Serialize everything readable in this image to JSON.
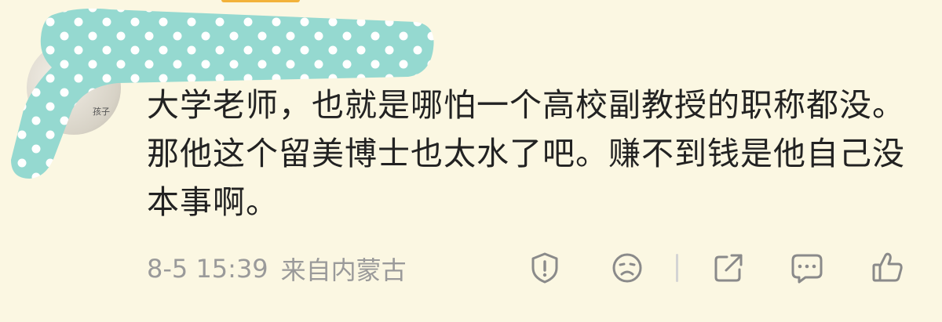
{
  "comment": {
    "avatar_label": "孩子",
    "text": "大学老师，也就是哪怕一个高校副教授的职称都没。那他这个留美博士也太水了吧。赚不到钱是他自己没本事啊。",
    "date": "8-5 15:39",
    "location": "来自内蒙古"
  },
  "actions": [
    {
      "name": "report",
      "icon": "report-icon"
    },
    {
      "name": "dislike",
      "icon": "sad-face-icon"
    },
    {
      "name": "share",
      "icon": "share-icon"
    },
    {
      "name": "reply",
      "icon": "comment-icon"
    },
    {
      "name": "like",
      "icon": "thumbs-up-icon"
    }
  ],
  "colors": {
    "background": "#fbf7e2",
    "mask": "#95d9d0",
    "text": "#222222",
    "meta": "#9a9a9a",
    "icon": "#8a8a8a"
  }
}
